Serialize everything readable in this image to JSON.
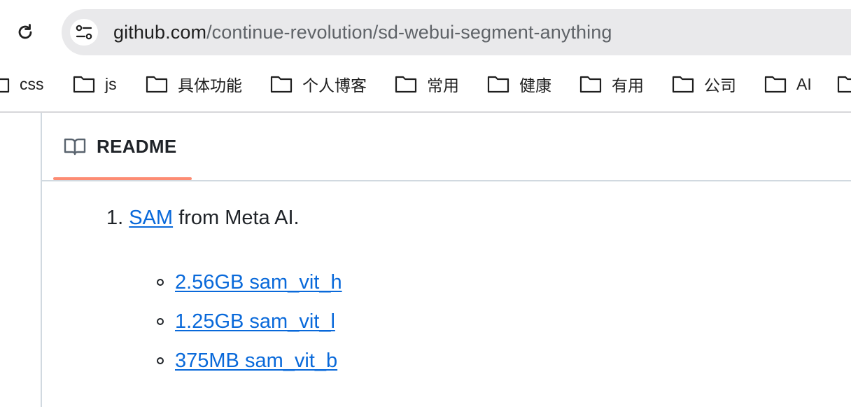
{
  "browser": {
    "url_host": "github.com",
    "url_path": "/continue-revolution/sd-webui-segment-anything",
    "bookmarks": [
      {
        "label": "css"
      },
      {
        "label": "js"
      },
      {
        "label": "具体功能"
      },
      {
        "label": "个人博客"
      },
      {
        "label": "常用"
      },
      {
        "label": "健康"
      },
      {
        "label": "有用"
      },
      {
        "label": "公司"
      },
      {
        "label": "AI"
      }
    ]
  },
  "readme": {
    "tab_label": "README",
    "item1": {
      "number": "1.",
      "link_text": "SAM",
      "rest_text": "from Meta AI."
    },
    "sub_items": [
      {
        "text": "2.56GB sam_vit_h"
      },
      {
        "text": "1.25GB sam_vit_l"
      },
      {
        "text": "375MB sam_vit_b"
      }
    ]
  },
  "colors": {
    "link": "#0969da",
    "tab_underline": "#fd8c73",
    "omnibox": "#e9e9eb"
  },
  "icons": {
    "reload": "reload-icon",
    "site_info": "tune-icon",
    "folder": "folder-icon",
    "readme": "book-icon",
    "bullet": "circle-bullet-icon"
  }
}
